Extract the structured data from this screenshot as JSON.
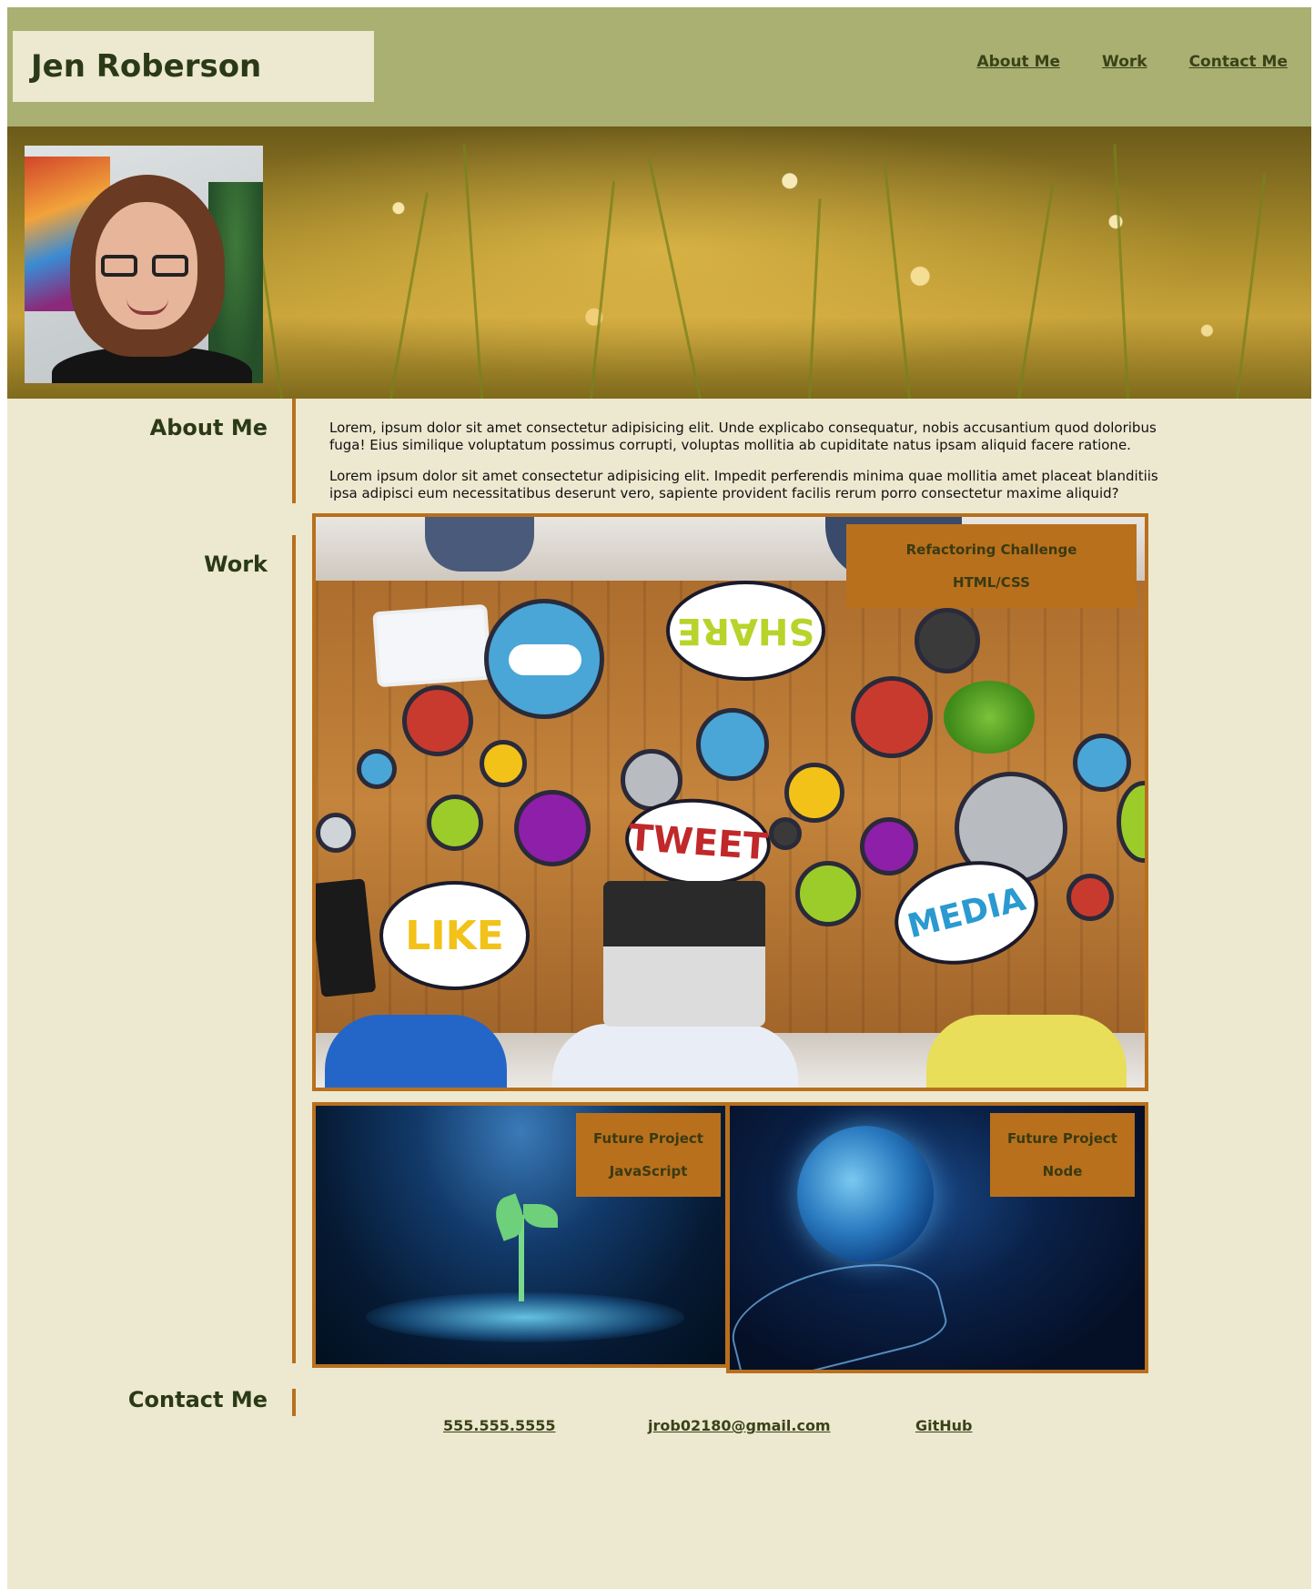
{
  "header": {
    "name": "Jen Roberson",
    "nav": [
      "About Me",
      "Work",
      "Contact Me"
    ]
  },
  "about": {
    "title": "About Me",
    "paragraphs": [
      "Lorem, ipsum dolor sit amet consectetur adipisicing elit. Unde explicabo consequatur, nobis accusantium quod doloribus fuga! Eius similique voluptatum possimus corrupti, voluptas mollitia ab cupiditate natus ipsam aliquid facere ratione.",
      "Lorem ipsum dolor sit amet consectetur adipisicing elit. Impedit perferendis minima quae mollitia amet placeat blanditiis ipsa adipisci eum necessitatibus deserunt vero, sapiente provident facilis rerum porro consectetur maxime aliquid?"
    ]
  },
  "work": {
    "title": "Work",
    "featured": {
      "project": "Refactoring Challenge",
      "tech": "HTML/CSS",
      "image_words": [
        "SHARE",
        "TWEET",
        "LIKE",
        "MEDIA"
      ]
    },
    "projects": [
      {
        "project": "Future Project",
        "tech": "JavaScript"
      },
      {
        "project": "Future Project",
        "tech": "Node"
      }
    ]
  },
  "contact": {
    "title": "Contact Me",
    "phone": "555.555.5555",
    "email": "jrob02180@gmail.com",
    "github": "GitHub"
  },
  "colors": {
    "header_bg": "#a9b072",
    "page_bg": "#ede8d0",
    "accent": "#b8701d",
    "text_dark": "#2a3a16"
  }
}
